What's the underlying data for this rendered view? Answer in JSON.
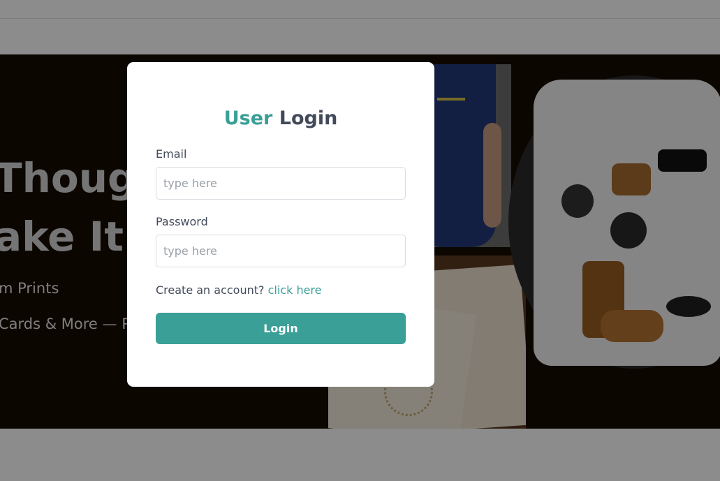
{
  "hero": {
    "headline_line1": "Though",
    "headline_line2": "ake It R",
    "subline1": "m Prints",
    "subline2": "Cards & More — Pri"
  },
  "modal": {
    "title_accent": "User",
    "title_main": "Login",
    "email": {
      "label": "Email",
      "placeholder": "type here",
      "value": ""
    },
    "password": {
      "label": "Password",
      "placeholder": "type here",
      "value": ""
    },
    "signup_prompt": "Create an account?",
    "signup_link": "click here",
    "login_button": "Login"
  },
  "colors": {
    "accent": "#3b9f97",
    "text": "#424a5a",
    "hero_bg": "#170b02",
    "overlay": "rgba(0,0,0,0.45)"
  }
}
